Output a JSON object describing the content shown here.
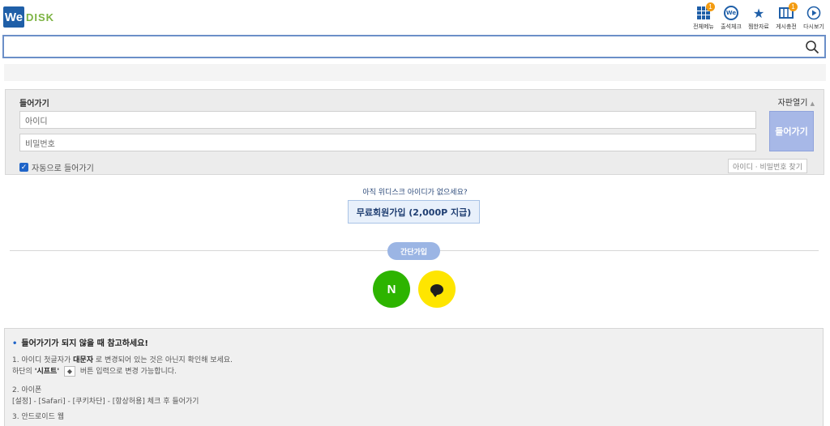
{
  "logo": {
    "we": "We",
    "disk": "DISK"
  },
  "top_icons": [
    {
      "name": "all-menu",
      "label": "전체메뉴",
      "icon": "grid-icon",
      "badge": "1"
    },
    {
      "name": "attendance",
      "label": "출석체크",
      "icon": "we-circle-icon"
    },
    {
      "name": "favorites",
      "label": "찜한자료",
      "icon": "star-icon"
    },
    {
      "name": "board-notice",
      "label": "게시충전",
      "icon": "coupon-icon",
      "badge": "1"
    },
    {
      "name": "replay",
      "label": "다시보기",
      "icon": "play-circle-icon"
    }
  ],
  "search": {
    "placeholder": "",
    "value": ""
  },
  "login": {
    "title": "들어가기",
    "keyboard_toggle": "자판열기",
    "id_placeholder": "아이디",
    "pw_placeholder": "비밀번호",
    "submit": "들어가기",
    "auto_login": "자동으로 들어가기",
    "auto_login_checked": true,
    "find_account": "아이디 · 비밀번호 찾기"
  },
  "signup": {
    "prompt": "아직 위디스크 아이디가 없으세요?",
    "button": "무료회원가입 (2,000P 지급)",
    "easy_label": "간단가입",
    "naver_letter": "N"
  },
  "help": {
    "title": "들어가기가 되지 않을 때 참고하세요!",
    "item1_prefix": "1. 아이디 첫글자가",
    "item1_bold": "대문자",
    "item1_suffix": "로 변경되어 있는 것은 아닌지 확인해 보세요.",
    "item1b_prefix": "하단의",
    "item1b_bold": "'시프트'",
    "item1b_key": "◆",
    "item1b_suffix": "버튼 입력으로 변경 가능합니다.",
    "item2_title": "2. 아이폰",
    "item2_body": "[설정] - [Safari] - [쿠키차단] - [항상허용] 체크 후 들어가기",
    "item3_title": "3. 안드로이드 웹"
  },
  "colors": {
    "brand": "#1f5fa8",
    "accent": "#f39c12",
    "naver": "#2db400",
    "kakao": "#fee500"
  }
}
